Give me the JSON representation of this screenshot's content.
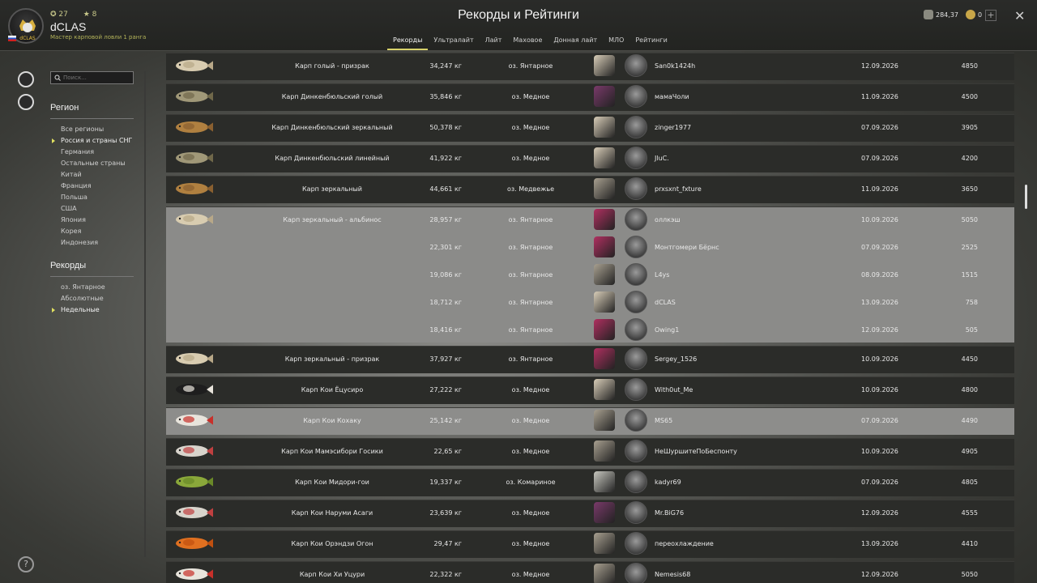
{
  "header": {
    "username": "dCLAS",
    "user_title": "Мастер карповой ловли 1 ранга",
    "stat_level": "27",
    "stat_stars": "8",
    "avatar_text": "dCLAS",
    "page_title": "Рекорды и Рейтинги",
    "tabs": [
      "Рекорды",
      "Ультралайт",
      "Лайт",
      "Маховое",
      "Донная лайт",
      "МЛО",
      "Рейтинги"
    ],
    "active_tab": "Рекорды",
    "silver": "284,37",
    "gold": "0",
    "plus": "+",
    "close": "✕"
  },
  "sidebar": {
    "search_placeholder": "Поиск...",
    "region_title": "Регион",
    "regions": [
      "Все регионы",
      "Россия и страны СНГ",
      "Германия",
      "Остальные страны",
      "Китай",
      "Франция",
      "Польша",
      "США",
      "Япония",
      "Корея",
      "Индонезия"
    ],
    "active_region": "Россия и страны СНГ",
    "records_title": "Рекорды",
    "records": [
      "оз. Янтарное",
      "Абсолютные",
      "Недельные"
    ],
    "active_record": "Недельные",
    "help": "?"
  },
  "colors": {
    "accent": "#d8d26a",
    "row_dark": "#2b2c29",
    "row_light": "#8d8d8b"
  },
  "rows": [
    {
      "name": "Карп голый - призрак",
      "weight": "34,247 кг",
      "loc": "оз. Янтарное",
      "player": "San0k1424h",
      "date": "12.09.2026",
      "score": "4850"
    },
    {
      "name": "Карп Динкенбюльский голый",
      "weight": "35,846 кг",
      "loc": "оз. Медное",
      "player": "мамаЧоли",
      "date": "11.09.2026",
      "score": "4500"
    },
    {
      "name": "Карп Динкенбюльский зеркальный",
      "weight": "50,378 кг",
      "loc": "оз. Медное",
      "player": "zinger1977",
      "date": "07.09.2026",
      "score": "3905"
    },
    {
      "name": "Карп Динкенбюльский линейный",
      "weight": "41,922 кг",
      "loc": "оз. Медное",
      "player": "JluC.",
      "date": "07.09.2026",
      "score": "4200"
    },
    {
      "name": "Карп зеркальный",
      "weight": "44,661 кг",
      "loc": "оз. Медвежье",
      "player": "prxsxnt_fxture",
      "date": "11.09.2026",
      "score": "3650"
    }
  ],
  "group": {
    "name": "Карп зеркальный - альбинос",
    "entries": [
      {
        "weight": "28,957 кг",
        "loc": "оз. Янтарное",
        "player": "оллкэш",
        "date": "10.09.2026",
        "score": "5050"
      },
      {
        "weight": "22,301 кг",
        "loc": "оз. Янтарное",
        "player": "Монтгомери Бёрнс",
        "date": "07.09.2026",
        "score": "2525"
      },
      {
        "weight": "19,086 кг",
        "loc": "оз. Янтарное",
        "player": "L4ys",
        "date": "08.09.2026",
        "score": "1515"
      },
      {
        "weight": "18,712 кг",
        "loc": "оз. Янтарное",
        "player": "dCLAS",
        "date": "13.09.2026",
        "score": "758"
      },
      {
        "weight": "18,416 кг",
        "loc": "оз. Янтарное",
        "player": "Owing1",
        "date": "12.09.2026",
        "score": "505"
      }
    ]
  },
  "rows2": [
    {
      "name": "Карп зеркальный - призрак",
      "weight": "37,927 кг",
      "loc": "оз. Янтарное",
      "player": "Sergey_1526",
      "date": "10.09.2026",
      "score": "4450"
    },
    {
      "name": "Карп Кои Ёцусиро",
      "weight": "27,222 кг",
      "loc": "оз. Медное",
      "player": "With0ut_Me",
      "date": "10.09.2026",
      "score": "4800"
    },
    {
      "name": "Карп Кои Кохаку",
      "weight": "25,142 кг",
      "loc": "оз. Медное",
      "player": "MS65",
      "date": "07.09.2026",
      "score": "4490"
    },
    {
      "name": "Карп Кои Мамэсибори Госики",
      "weight": "22,65 кг",
      "loc": "оз. Медное",
      "player": "НеШуршитеПоБеспонту",
      "date": "10.09.2026",
      "score": "4905"
    },
    {
      "name": "Карп Кои Мидори-гои",
      "weight": "19,337 кг",
      "loc": "оз. Комариное",
      "player": "kadyr69",
      "date": "07.09.2026",
      "score": "4805"
    },
    {
      "name": "Карп Кои Наруми Асаги",
      "weight": "23,639 кг",
      "loc": "оз. Медное",
      "player": "Mr.BiG76",
      "date": "12.09.2026",
      "score": "4555"
    },
    {
      "name": "Карп Кои Орэндзи Огон",
      "weight": "29,47 кг",
      "loc": "оз. Медное",
      "player": "переохлаждение",
      "date": "13.09.2026",
      "score": "4410"
    },
    {
      "name": "Карп Кои Хи Уцури",
      "weight": "22,322 кг",
      "loc": "оз. Медное",
      "player": "Nemesis68",
      "date": "12.09.2026",
      "score": "5050"
    }
  ]
}
